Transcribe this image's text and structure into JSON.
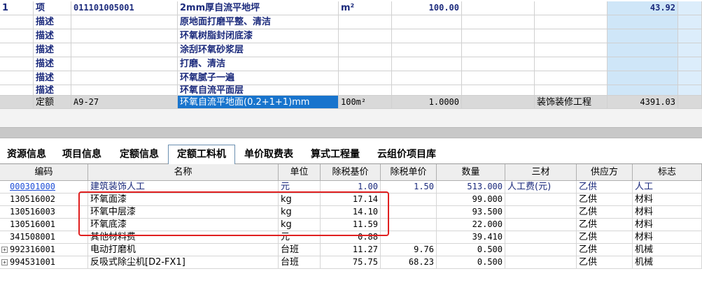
{
  "item": {
    "seq": "1",
    "type": "项",
    "code": "011101005001",
    "name": "2mm厚自流平地坪",
    "unit": "m²",
    "quantity": "100.00",
    "price": "43.92"
  },
  "descriptions": [
    {
      "type": "描述",
      "text": "原地面打磨平整、清洁"
    },
    {
      "type": "描述",
      "text": "环氧树脂封闭底漆"
    },
    {
      "type": "描述",
      "text": "涂刮环氧砂浆层"
    },
    {
      "type": "描述",
      "text": "打磨、清洁"
    },
    {
      "type": "描述",
      "text": "环氧腻子一遍"
    },
    {
      "type": "描述",
      "text": "环氧自流平面层"
    }
  ],
  "quota": {
    "type": "定额",
    "code": "A9-27",
    "name": "环氧自流平地面(0.2+1+1)mm",
    "unit": "100m²",
    "quantity": "1.0000",
    "category": "装饰装修工程",
    "amount": "4391.03"
  },
  "tabs": [
    {
      "label": "资源信息"
    },
    {
      "label": "项目信息"
    },
    {
      "label": "定额信息"
    },
    {
      "label": "定额工料机"
    },
    {
      "label": "单价取费表"
    },
    {
      "label": "算式工程量"
    },
    {
      "label": "云组价项目库"
    }
  ],
  "columns": {
    "code": "编码",
    "name": "名称",
    "unit": "单位",
    "base_price": "除税基价",
    "unit_price": "除税单价",
    "qty": "数量",
    "three": "三材",
    "supplier": "供应方",
    "flag": "标志"
  },
  "rows": [
    {
      "code": "000301000",
      "name": "建筑装饰人工",
      "unit": "元",
      "base_price": "1.00",
      "unit_price": "1.50",
      "qty": "513.000",
      "three": "人工费(元)",
      "supplier": "乙供",
      "flag": "人工",
      "expand": ""
    },
    {
      "code": "130516002",
      "name": "环氧面漆",
      "unit": "kg",
      "base_price": "17.14",
      "unit_price": "",
      "qty": "99.000",
      "three": "",
      "supplier": "乙供",
      "flag": "材料",
      "expand": ""
    },
    {
      "code": "130516003",
      "name": "环氧中层漆",
      "unit": "kg",
      "base_price": "14.10",
      "unit_price": "",
      "qty": "93.500",
      "three": "",
      "supplier": "乙供",
      "flag": "材料",
      "expand": ""
    },
    {
      "code": "130516001",
      "name": "环氧底漆",
      "unit": "kg",
      "base_price": "11.59",
      "unit_price": "",
      "qty": "22.000",
      "three": "",
      "supplier": "乙供",
      "flag": "材料",
      "expand": ""
    },
    {
      "code": "341508001",
      "name": "其他材料费",
      "unit": "元",
      "base_price": "0.88",
      "unit_price": "",
      "qty": "39.410",
      "three": "",
      "supplier": "乙供",
      "flag": "材料",
      "expand": ""
    },
    {
      "code": "992316001",
      "name": "电动打磨机",
      "unit": "台班",
      "base_price": "11.27",
      "unit_price": "9.76",
      "qty": "0.500",
      "three": "",
      "supplier": "乙供",
      "flag": "机械",
      "expand": "+"
    },
    {
      "code": "994531001",
      "name": "反吸式除尘机[D2-FX1]",
      "unit": "台班",
      "base_price": "75.75",
      "unit_price": "68.23",
      "qty": "0.500",
      "three": "",
      "supplier": "乙供",
      "flag": "机械",
      "expand": "+"
    }
  ],
  "colors": {
    "selected": "#1874cd",
    "highlight_box": "#e02020",
    "price_column": "#cfe6f8"
  }
}
